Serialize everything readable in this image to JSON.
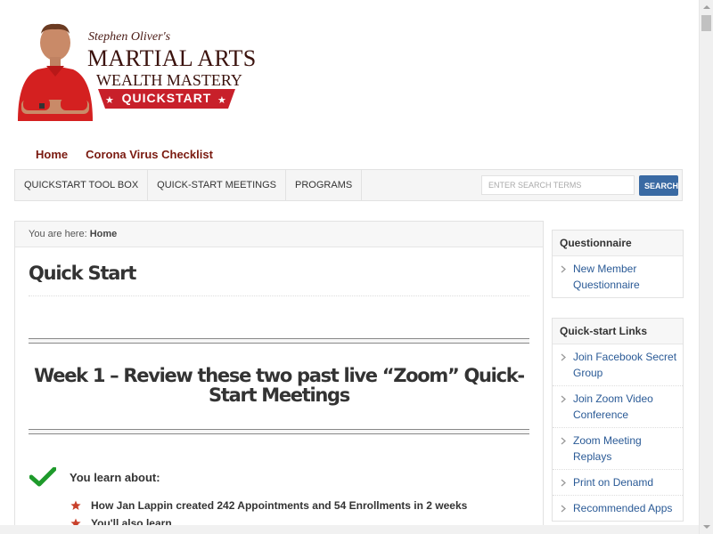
{
  "header": {
    "logo": {
      "byline": "Stephen Oliver's",
      "line1": "MARTIAL ARTS",
      "line2": "WEALTH MASTERY",
      "banner": "QUICKSTART"
    }
  },
  "top_nav": [
    {
      "label": "Home"
    },
    {
      "label": "Corona Virus Checklist"
    }
  ],
  "main_nav": {
    "items": [
      {
        "label": "QUICKSTART TOOL BOX"
      },
      {
        "label": "QUICK-START MEETINGS"
      },
      {
        "label": "PROGRAMS"
      }
    ],
    "search": {
      "placeholder": "ENTER SEARCH TERMS",
      "button_label": "SEARCH"
    }
  },
  "content": {
    "breadcrumb": {
      "prefix": "You are here:",
      "current": "Home"
    },
    "title": "Quick Start",
    "week_heading": "Week 1 – Review these two past live “Zoom” Quick-Start Meetings",
    "learn_label": "You learn about:",
    "bullets": [
      "How Jan Lappin created 242 Appointments and 54 Enrollments in 2 weeks",
      "You'll also learn"
    ]
  },
  "sidebar": {
    "widgets": [
      {
        "title": "Questionnaire",
        "items": [
          "New Member Questionnaire"
        ]
      },
      {
        "title": "Quick-start Links",
        "items": [
          "Join Facebook Secret Group",
          "Join Zoom Video Conference",
          "Zoom Meeting Replays",
          "Print on Denamd",
          "Recommended Apps"
        ]
      }
    ]
  },
  "colors": {
    "brand_maroon": "#7a1a10",
    "link_blue": "#2a5a96",
    "search_button": "#3a6aa3",
    "banner_red": "#c8202a",
    "check_green": "#1e9a2b",
    "star_red": "#c8402a"
  },
  "icons": {
    "chevron": "chevron-right-icon",
    "check": "checkmark-icon",
    "bullet": "star-bullet-icon"
  }
}
